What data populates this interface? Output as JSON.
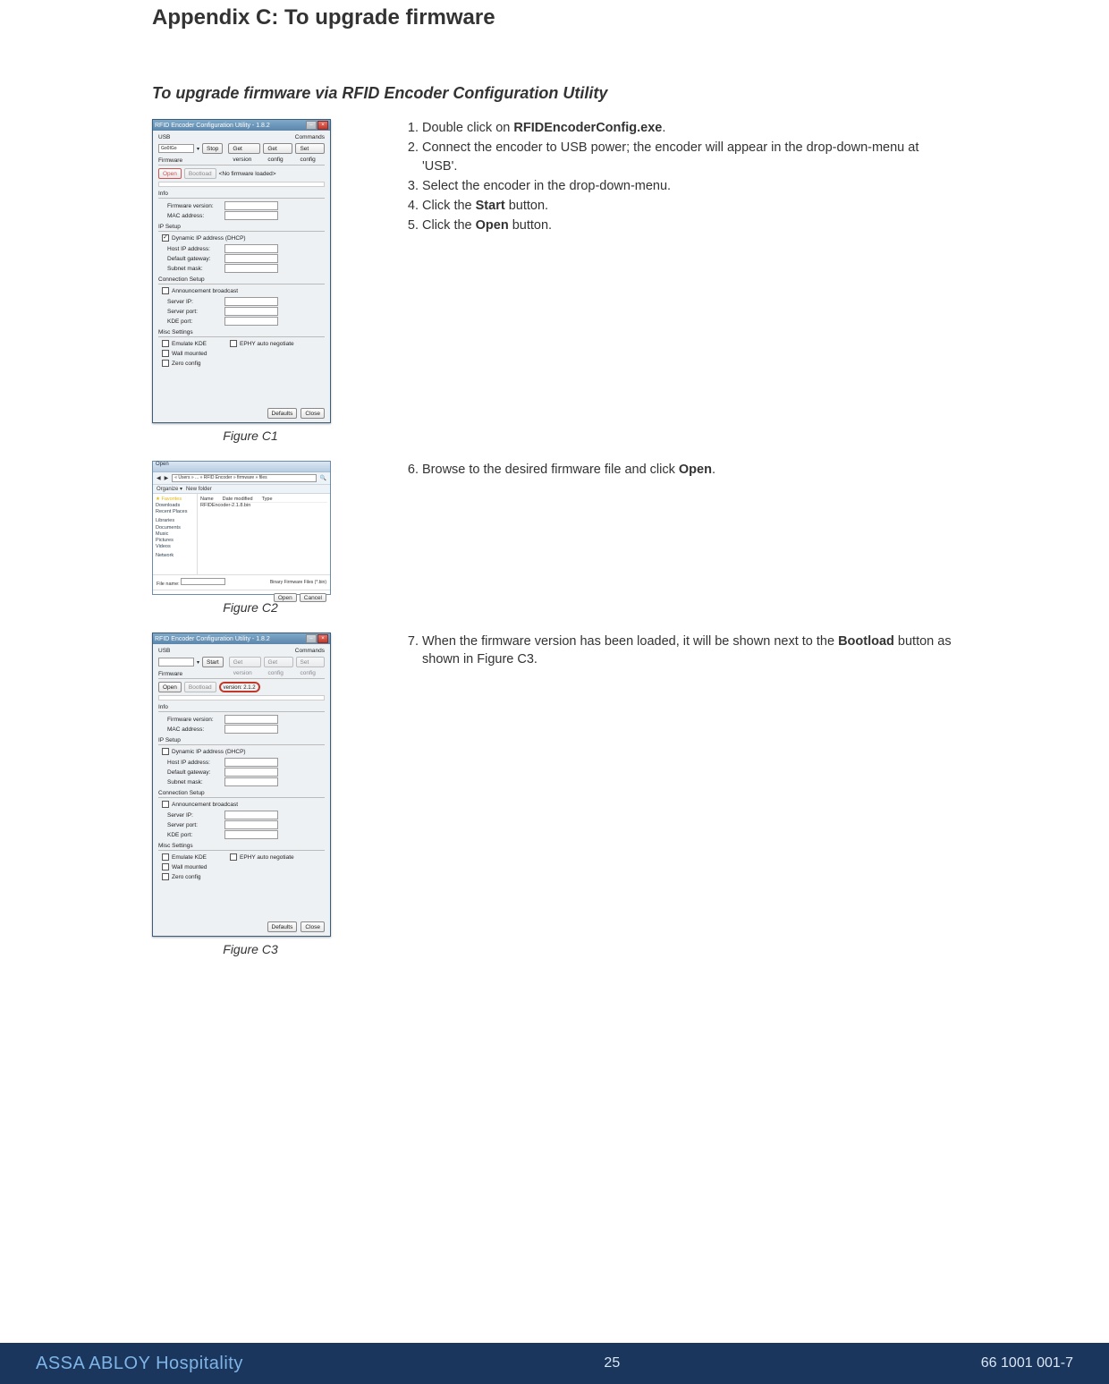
{
  "heading": "Appendix C: To upgrade firmware",
  "subheading": "To upgrade firmware via RFID Encoder Configuration Utility",
  "figures": {
    "c1": {
      "caption": "Figure C1",
      "title": "RFID Encoder Configuration Utility - 1.8.2"
    },
    "c2": {
      "caption": "Figure C2",
      "title": "Open"
    },
    "c3": {
      "caption": "Figure C3",
      "title": "RFID Encoder Configuration Utility - 1.8.2"
    }
  },
  "steps_a": [
    {
      "pre": "Double click on ",
      "bold": "RFIDEncoderConfig.exe",
      "post": "."
    },
    {
      "pre": "Connect the encoder to USB power; the encoder will appear in the drop-down-menu at 'USB'."
    },
    {
      "pre": "Select the encoder in the drop-down-menu."
    },
    {
      "pre": "Click the ",
      "bold": "Start",
      "post": " button."
    },
    {
      "pre": "Click the ",
      "bold": "Open",
      "post": " button."
    }
  ],
  "steps_b": [
    {
      "pre": "Browse to the desired firmware file and click ",
      "bold": "Open",
      "post": "."
    }
  ],
  "steps_c": [
    {
      "pre": "When the firmware version has been loaded, it will be shown next to the ",
      "bold": "Bootload",
      "post": " button as shown in Figure C3."
    }
  ],
  "win": {
    "usb_label": "USB",
    "dropdown_value": "Go0IGo",
    "cmds_label": "Commands",
    "btn_stop": "Stop",
    "btn_start": "Start",
    "btn_getver": "Get version",
    "btn_getcfg": "Get config",
    "btn_setcfg": "Set config",
    "btn_open": "Open",
    "btn_bootload": "Bootload",
    "fw_status": "<No firmware loaded>",
    "version_label": "version: 2.1.2",
    "grp_fw": "Firmware",
    "grp_info": "Info",
    "lbl_fwver": "Firmware version:",
    "lbl_mac": "MAC address:",
    "grp_ip": "IP Setup",
    "cb_dhcp": "Dynamic IP address (DHCP)",
    "lbl_host": "Host IP address:",
    "lbl_gw": "Default gateway:",
    "lbl_mask": "Subnet mask:",
    "grp_conn": "Connection Setup",
    "cb_ann": "Announcement broadcast",
    "lbl_srvip": "Server IP:",
    "lbl_srvport": "Server port:",
    "lbl_kdeport": "KDE port:",
    "grp_misc": "Misc Settings",
    "cb_emulate": "Emulate KDE",
    "cb_wall": "Wall mounted",
    "cb_zero": "Zero config",
    "cb_ephy": "EPHY auto negotiate",
    "btn_defaults": "Defaults",
    "btn_close": "Close"
  },
  "dialog": {
    "path": "« Users » ... » RFID Encoder » firmware » files",
    "organize": "Organize ▾",
    "newfolder": "New folder",
    "fav": "★ Favorites",
    "fav_items": [
      "Downloads",
      "Recent Places"
    ],
    "lib": "Libraries",
    "lib_items": [
      "Documents",
      "Music",
      "Pictures",
      "Videos"
    ],
    "net": "Network",
    "col_name": "Name",
    "col_date": "Date modified",
    "col_type": "Type",
    "file": "RFIDEncoder-2.1.8.bin",
    "filename_lbl": "File name:",
    "filter": "Binary Firmware Files (*.bin)",
    "btn_open": "Open",
    "btn_cancel": "Cancel"
  },
  "footer": {
    "brand": "ASSA ABLOY Hospitality",
    "page": "25",
    "doc": "66 1001 001-7"
  }
}
